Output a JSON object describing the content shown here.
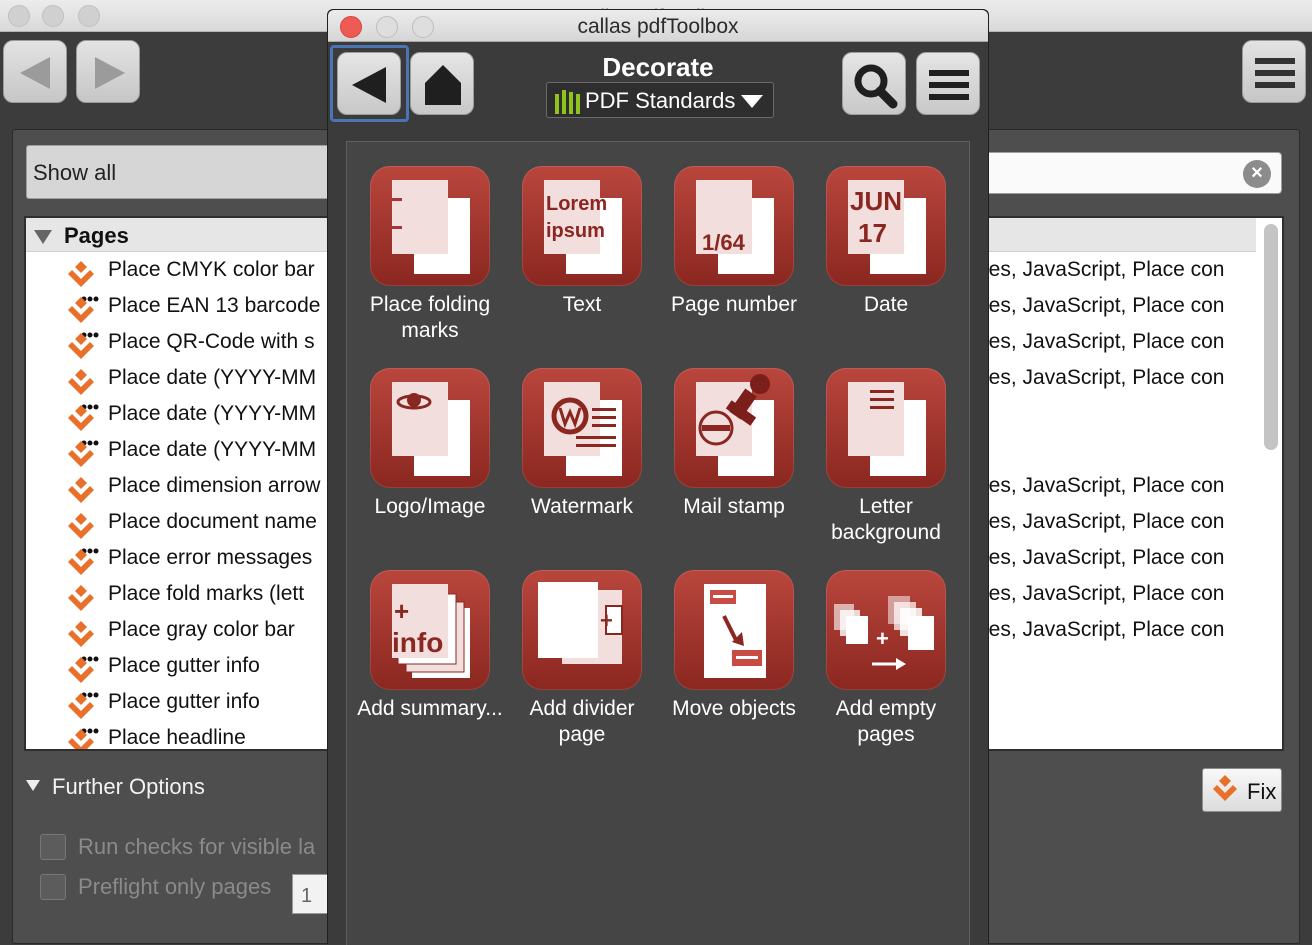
{
  "main_window": {
    "title": "callas pdfToolbox",
    "filter_label": "Show all",
    "clear_symbol": "×",
    "list": {
      "group_label": "Pages",
      "rows": [
        {
          "name": "Place CMYK color bar",
          "desc": "les, JavaScript, Place con",
          "icon": "fixup-icon"
        },
        {
          "name": "Place EAN 13 barcode",
          "desc": "les, JavaScript, Place con",
          "icon": "variable-fixup-icon"
        },
        {
          "name": "Place QR-Code with s",
          "desc": "les, JavaScript, Place con",
          "icon": "variable-fixup-icon"
        },
        {
          "name": "Place date (YYYY-MM",
          "desc": "les, JavaScript, Place con",
          "icon": "fixup-icon"
        },
        {
          "name": "Place date (YYYY-MM",
          "desc": "",
          "icon": "variable-fixup-icon"
        },
        {
          "name": "Place date (YYYY-MM",
          "desc": "",
          "icon": "variable-fixup-icon"
        },
        {
          "name": "Place dimension arrow",
          "desc": "les, JavaScript, Place con",
          "icon": "fixup-icon"
        },
        {
          "name": "Place document name",
          "desc": "les, JavaScript, Place con",
          "icon": "fixup-icon"
        },
        {
          "name": "Place error messages",
          "desc": "les, JavaScript, Place con",
          "icon": "variable-fixup-icon"
        },
        {
          "name": "Place fold marks (lett",
          "desc": "les, JavaScript, Place con",
          "icon": "fixup-icon"
        },
        {
          "name": "Place gray color bar",
          "desc": "les, JavaScript, Place con",
          "icon": "fixup-icon"
        },
        {
          "name": "Place gutter info",
          "desc": "",
          "icon": "variable-fixup-icon"
        },
        {
          "name": "Place gutter info",
          "desc": "",
          "icon": "variable-fixup-icon"
        },
        {
          "name": "Place headline",
          "desc": "",
          "icon": "variable-fixup-icon"
        }
      ]
    },
    "further_options_label": "Further Options",
    "option_visible_layers": "Run checks for visible la",
    "option_preflight_pages": "Preflight only pages",
    "page_from_value": "1",
    "fix_label": "Fix"
  },
  "palette": {
    "title": "callas pdfToolbox",
    "section_title": "Decorate",
    "library_dropdown": "PDF Standards",
    "tiles": [
      {
        "label": "Place folding marks",
        "icon": "folding-marks-icon"
      },
      {
        "label": "Text",
        "icon": "text-icon",
        "glyph1": "Lorem",
        "glyph2": "ipsum"
      },
      {
        "label": "Page number",
        "icon": "page-number-icon",
        "glyph1": "1/64"
      },
      {
        "label": "Date",
        "icon": "date-icon",
        "glyph1": "JUN",
        "glyph2": "17"
      },
      {
        "label": "Logo/Image",
        "icon": "logo-image-icon"
      },
      {
        "label": "Watermark",
        "icon": "watermark-icon"
      },
      {
        "label": "Mail stamp",
        "icon": "mail-stamp-icon"
      },
      {
        "label": "Letter background",
        "icon": "letter-background-icon"
      },
      {
        "label": "Add summary...",
        "icon": "add-summary-icon",
        "glyph1": "+",
        "glyph2": "info"
      },
      {
        "label": "Add divider page",
        "icon": "add-divider-page-icon"
      },
      {
        "label": "Move objects",
        "icon": "move-objects-icon"
      },
      {
        "label": "Add empty pages",
        "icon": "add-empty-pages-icon"
      }
    ]
  },
  "colors": {
    "accent_red": "#a8352d",
    "fixup_orange": "#e8702a",
    "focus_blue": "#4a74b4",
    "library_green": "#8fc31f"
  }
}
